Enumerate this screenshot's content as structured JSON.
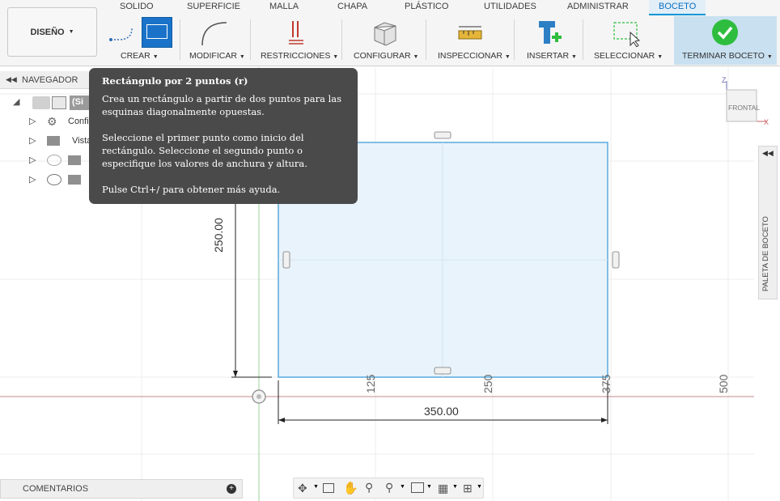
{
  "toolbar": {
    "design_label": "DISEÑO",
    "tabs": [
      "SOLIDO",
      "SUPERFICIE",
      "MALLA",
      "CHAPA",
      "PLÁSTICO",
      "UTILIDADES",
      "ADMINISTRAR",
      "BOCETO"
    ],
    "active_tab": "BOCETO",
    "groups": [
      "CREAR",
      "MODIFICAR",
      "RESTRICCIONES",
      "CONFIGURAR",
      "INSPECCIONAR",
      "INSERTAR",
      "SELECCIONAR",
      "TERMINAR BOCETO"
    ],
    "accent_color": "#0696d7",
    "finish_color": "#2ebd3e"
  },
  "navigator": {
    "title": "NAVEGADOR",
    "root_label": "(Si",
    "rows": [
      "Confi",
      "Vista",
      "",
      ""
    ]
  },
  "tooltip": {
    "title": "Rectángulo por 2 puntos (r)",
    "p1": "Crea un rectángulo a partir de dos puntos para las esquinas diagonalmente opuestas.",
    "p2": "Seleccione el primer punto como inicio del rectángulo. Seleccione el segundo punto o especifique los valores de anchura y altura.",
    "p3": "Pulse Ctrl+/ para obtener más ayuda."
  },
  "viewcube": {
    "face_label": "FRONTAL",
    "axis_z": "Z",
    "axis_x": "X"
  },
  "sketch": {
    "width_dim": "350.00",
    "height_dim": "250.00",
    "ruler_ticks": [
      "125",
      "250",
      "375",
      "500"
    ],
    "rect_color": "#4aa3d8",
    "fill_color": "#e4f1fa"
  },
  "palette": {
    "title": "PALETA DE BOCETO"
  },
  "comments": {
    "title": "COMENTARIOS"
  }
}
